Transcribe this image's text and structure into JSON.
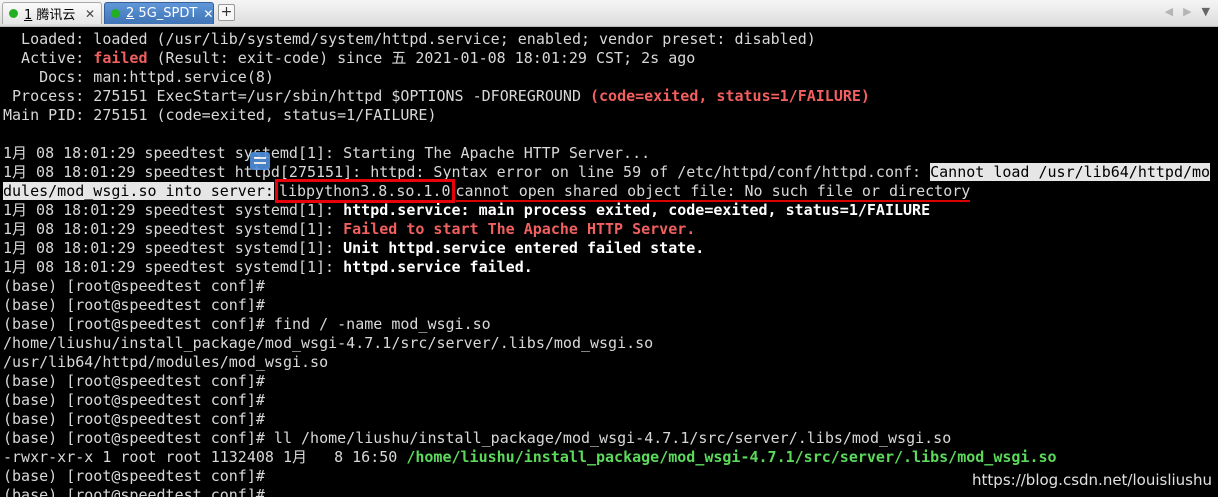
{
  "tabs": [
    {
      "num": "1",
      "label": "腾讯云",
      "active": false
    },
    {
      "num": "2",
      "label": "5G_SPDT",
      "active": true
    }
  ],
  "new_tab": "+",
  "nav": {
    "left": "◀",
    "right": "▶",
    "menu": "▼"
  },
  "colors": {
    "failed": "#f25f5f",
    "path_green": "#5bd95b",
    "highlight_box": "#e8000b"
  },
  "terminal": {
    "l1_a": "  Loaded: loaded (/usr/lib/systemd/system/httpd.service; enabled; vendor preset: disabled)",
    "l2_a": "  Active: ",
    "l2_b": "failed",
    "l2_c": " (Result: exit-code) since 五 2021-01-08 18:01:29 CST; 2s ago",
    "l3_a": "    Docs: man:httpd.service(8)",
    "l4_a": " Process: 275151 ExecStart=/usr/sbin/httpd $OPTIONS -DFOREGROUND ",
    "l4_b": "(code=exited, status=1/FAILURE)",
    "l5_a": "Main PID: 275151 (code=exited, status=1/FAILURE)",
    "l7_a": "1月 08 18:01:29 speedtest systemd[1]: Starting The Apache HTTP Server...",
    "l8_a": "1月 08 18:01:29 speedtest httpd[275151]: httpd: Syntax error on line 59 of /etc/httpd/conf/httpd.conf: ",
    "l8_b": "Cannot load /usr/lib64/httpd/mo",
    "l9_a": "dules/mod_wsgi.so into server:",
    "l9_b": "libpython3.8.so.1.0",
    "l9_c": "cannot open shared object file: No such file or directory",
    "l10_a": "1月 08 18:01:29 speedtest systemd[1]: ",
    "l10_b": "httpd.service: main process exited, code=exited, status=1/FAILURE",
    "l11_a": "1月 08 18:01:29 speedtest systemd[1]: ",
    "l11_b": "Failed to start The Apache HTTP Server.",
    "l12_a": "1月 08 18:01:29 speedtest systemd[1]: ",
    "l12_b": "Unit httpd.service entered failed state.",
    "l13_a": "1月 08 18:01:29 speedtest systemd[1]: ",
    "l13_b": "httpd.service failed.",
    "prompt": "(base) [root@speedtest conf]#",
    "cmd_find": " find / -name mod_wsgi.so",
    "find_r1": "/home/liushu/install_package/mod_wsgi-4.7.1/src/server/.libs/mod_wsgi.so",
    "find_r2": "/usr/lib64/httpd/modules/mod_wsgi.so",
    "cmd_ll": " ll /home/liushu/install_package/mod_wsgi-4.7.1/src/server/.libs/mod_wsgi.so",
    "ll_a": "-rwxr-xr-x 1 root root 1132408 1月   8 16:50 ",
    "ll_b": "/home/liushu/install_package/mod_wsgi-4.7.1/src/server/.libs/mod_wsgi.so"
  },
  "watermark": "https://blog.csdn.net/louisliushu"
}
